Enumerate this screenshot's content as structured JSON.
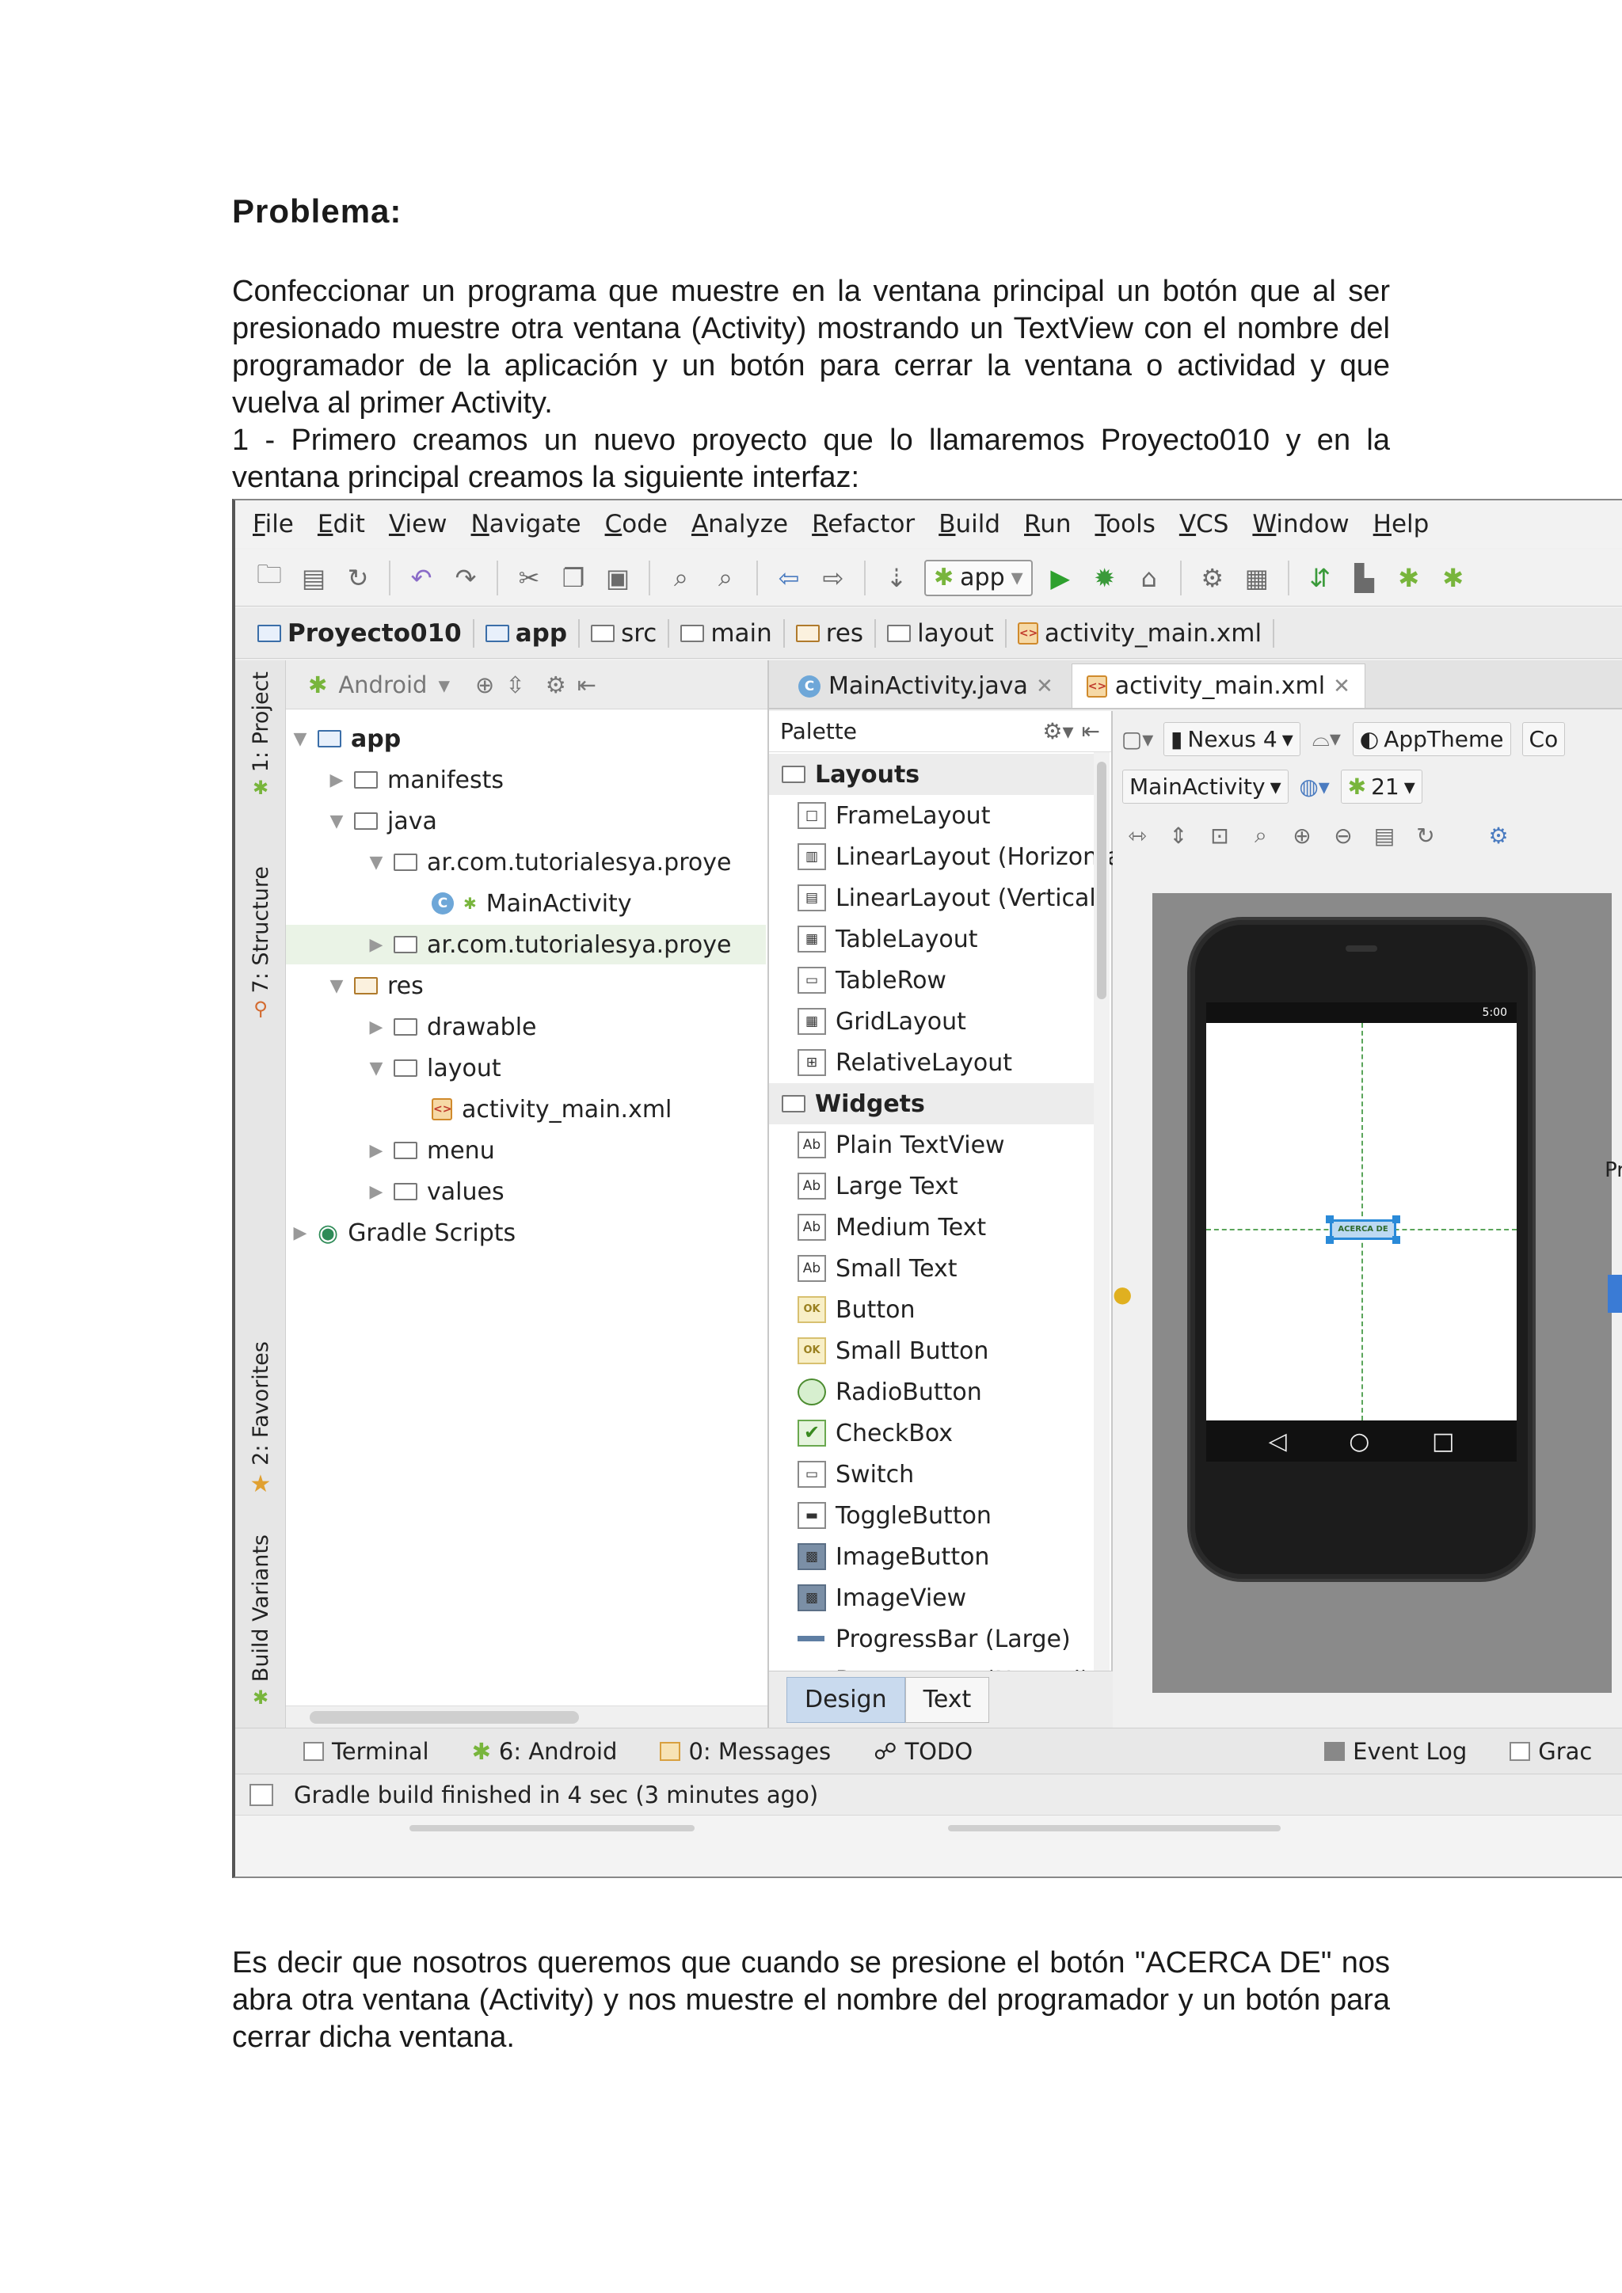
{
  "document": {
    "heading": "Problema:",
    "paragraph1": "Confeccionar un programa que muestre en la ventana principal un botón que al ser presionado muestre otra ventana (Activity) mostrando un TextView con el nombre del programador de la aplicación y un botón para cerrar la ventana o actividad y que vuelva al primer Activity.",
    "paragraph2": "1 - Primero creamos un nuevo proyecto que lo llamaremos Proyecto010 y en la ventana principal creamos la siguiente interfaz:",
    "paragraph3": "Es decir que nosotros queremos que cuando se presione el botón \"ACERCA DE\" nos abra otra ventana (Activity) y nos muestre el nombre del programador y un botón para cerrar dicha ventana."
  },
  "ide": {
    "menu": [
      "File",
      "Edit",
      "View",
      "Navigate",
      "Code",
      "Analyze",
      "Refactor",
      "Build",
      "Run",
      "Tools",
      "VCS",
      "Window",
      "Help"
    ],
    "toolbar": {
      "run_config": "app",
      "icons": [
        "open-folder-icon",
        "save-icon",
        "sync-icon",
        "undo-icon",
        "redo-icon",
        "cut-icon",
        "copy-icon",
        "paste-icon",
        "find-icon",
        "replace-icon",
        "back-icon",
        "forward-icon",
        "make-icon",
        "run-icon",
        "debug-icon",
        "attach-debugger-icon",
        "project-structure-icon",
        "sdk-manager-icon",
        "avd-manager-icon",
        "android-monitor-icon"
      ]
    },
    "breadcrumb": [
      "Proyecto010",
      "app",
      "src",
      "main",
      "res",
      "layout",
      "activity_main.xml"
    ],
    "left_strip": {
      "project": "1: Project",
      "structure": "7: Structure",
      "favorites": "2: Favorites",
      "build_variants": "Build Variants"
    },
    "project_panel": {
      "view_mode": "Android",
      "tree": {
        "app": "app",
        "manifests": "manifests",
        "java": "java",
        "pkg1": "ar.com.tutorialesya.proye",
        "main_activity": "MainActivity",
        "pkg2": "ar.com.tutorialesya.proye",
        "res": "res",
        "drawable": "drawable",
        "layout": "layout",
        "activity_main": "activity_main.xml",
        "menu": "menu",
        "values": "values",
        "gradle": "Gradle Scripts"
      }
    },
    "editor_tabs": [
      "MainActivity.java",
      "activity_main.xml"
    ],
    "palette": {
      "title": "Palette",
      "layouts_group": "Layouts",
      "layouts": [
        "FrameLayout",
        "LinearLayout (Horizontal)",
        "LinearLayout (Vertical)",
        "TableLayout",
        "TableRow",
        "GridLayout",
        "RelativeLayout"
      ],
      "widgets_group": "Widgets",
      "widgets": [
        "Plain TextView",
        "Large Text",
        "Medium Text",
        "Small Text",
        "Button",
        "Small Button",
        "RadioButton",
        "CheckBox",
        "Switch",
        "ToggleButton",
        "ImageButton",
        "ImageView",
        "ProgressBar (Large)",
        "ProgressBar (Normal)"
      ]
    },
    "designer": {
      "device": "Nexus 4",
      "theme": "AppTheme",
      "activity": "MainActivity",
      "api": "21",
      "partial_right_top": "Co",
      "partial_right_mid": "Pr",
      "status_time": "5:00",
      "button_text": "ACERCA DE"
    },
    "design_tabs": [
      "Design",
      "Text"
    ],
    "bottom_tools": {
      "terminal": "Terminal",
      "android": "6: Android",
      "messages": "0: Messages",
      "todo": "TODO",
      "event_log": "Event Log",
      "gradle": "Grac"
    },
    "status_message": "Gradle build finished in 4 sec (3 minutes ago)"
  }
}
